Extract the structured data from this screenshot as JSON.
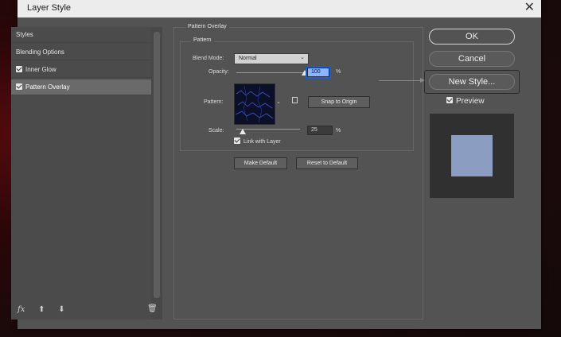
{
  "window": {
    "title": "Layer Style",
    "close_glyph": "✕"
  },
  "left_panel": {
    "items": [
      {
        "label": "Styles",
        "checkbox": false,
        "selected": false
      },
      {
        "label": "Blending Options",
        "checkbox": false,
        "selected": false
      },
      {
        "label": "Inner Glow",
        "checkbox": true,
        "selected": false
      },
      {
        "label": "Pattern Overlay",
        "checkbox": true,
        "selected": true
      }
    ],
    "bottom_icons": [
      "fx-icon",
      "arrow-up-icon",
      "arrow-down-icon",
      "trash-icon"
    ],
    "fx_label": "fx"
  },
  "pattern_overlay": {
    "section_title": "Pattern Overlay",
    "group_title": "Pattern",
    "blend_mode_label": "Blend Mode:",
    "blend_mode_value": "Normal",
    "opacity_label": "Opacity:",
    "opacity_value": "100",
    "percent": "%",
    "pattern_label": "Pattern:",
    "snap_button": "Snap to Origin",
    "scale_label": "Scale:",
    "scale_value": "25",
    "link_label": "Link with Layer",
    "link_checked": true,
    "make_default": "Make Default",
    "reset_default": "Reset to Default",
    "opacity_fraction": 1.0,
    "scale_fraction": 0.1
  },
  "right_panel": {
    "ok": "OK",
    "cancel": "Cancel",
    "new_style": "New Style...",
    "preview_label": "Preview",
    "preview_checked": true,
    "preview_color": "#8b9dc0"
  }
}
